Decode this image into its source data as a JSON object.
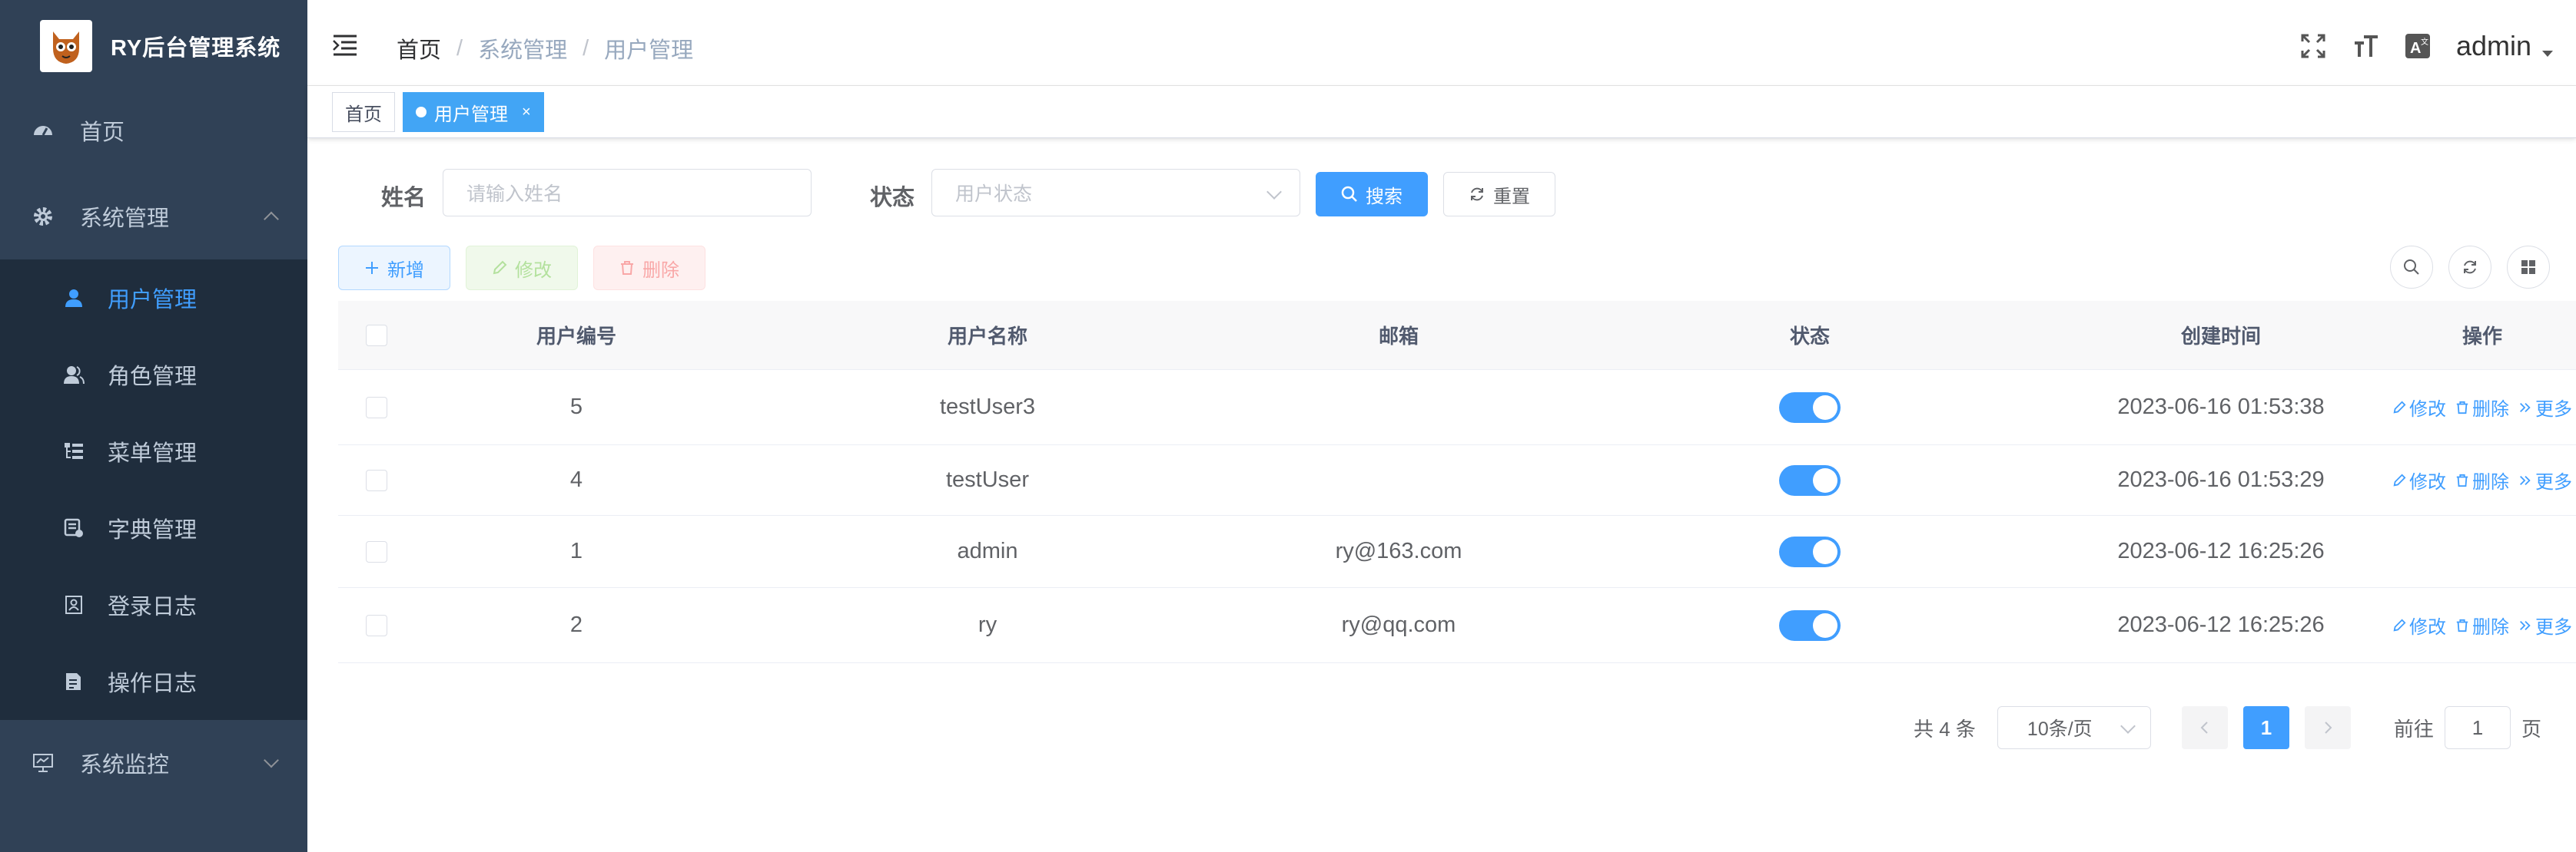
{
  "app": {
    "title": "RY后台管理系统"
  },
  "sidebar": {
    "home": {
      "label": "首页",
      "icon": "dashboard-icon"
    },
    "system": {
      "label": "系统管理",
      "icon": "gear-icon",
      "expanded": true,
      "items": [
        {
          "label": "用户管理",
          "icon": "user-icon",
          "active": true
        },
        {
          "label": "角色管理",
          "icon": "peoples-icon"
        },
        {
          "label": "菜单管理",
          "icon": "tree-table-icon"
        },
        {
          "label": "字典管理",
          "icon": "dict-icon"
        },
        {
          "label": "登录日志",
          "icon": "login-log-icon"
        },
        {
          "label": "操作日志",
          "icon": "form-log-icon"
        }
      ]
    },
    "monitor": {
      "label": "系统监控",
      "icon": "monitor-icon",
      "expanded": false
    }
  },
  "navbar": {
    "breadcrumb": [
      "首页",
      "系统管理",
      "用户管理"
    ],
    "username": "admin",
    "tools": [
      "fullscreen-icon",
      "font-size-icon",
      "language-icon"
    ]
  },
  "tags": [
    {
      "label": "首页",
      "active": false
    },
    {
      "label": "用户管理",
      "active": true,
      "close": "×"
    }
  ],
  "search": {
    "name_label": "姓名",
    "name_placeholder": "请输入姓名",
    "status_label": "状态",
    "status_placeholder": "用户状态",
    "search_button": "搜索",
    "reset_button": "重置"
  },
  "toolbar": {
    "add": "新增",
    "edit": "修改",
    "delete": "删除"
  },
  "table": {
    "columns": [
      "用户编号",
      "用户名称",
      "邮箱",
      "状态",
      "创建时间",
      "操作"
    ],
    "rows": [
      {
        "id": "5",
        "name": "testUser3",
        "email": "",
        "status": true,
        "created": "2023-06-16 01:53:38",
        "ops": true
      },
      {
        "id": "4",
        "name": "testUser",
        "email": "",
        "status": true,
        "created": "2023-06-16 01:53:29",
        "ops": true
      },
      {
        "id": "1",
        "name": "admin",
        "email": "ry@163.com",
        "status": true,
        "created": "2023-06-12 16:25:26",
        "ops": false
      },
      {
        "id": "2",
        "name": "ry",
        "email": "ry@qq.com",
        "status": true,
        "created": "2023-06-12 16:25:26",
        "ops": true
      }
    ],
    "op_labels": {
      "edit": "修改",
      "delete": "删除",
      "more": "更多"
    }
  },
  "pagination": {
    "total": "共 4 条",
    "page_size": "10条/页",
    "current_page": "1",
    "goto_label": "前往",
    "goto_value": "1",
    "page_unit": "页"
  },
  "colors": {
    "primary": "#409eff",
    "sidebar": "#304156",
    "submenu": "#1f2d3d"
  }
}
